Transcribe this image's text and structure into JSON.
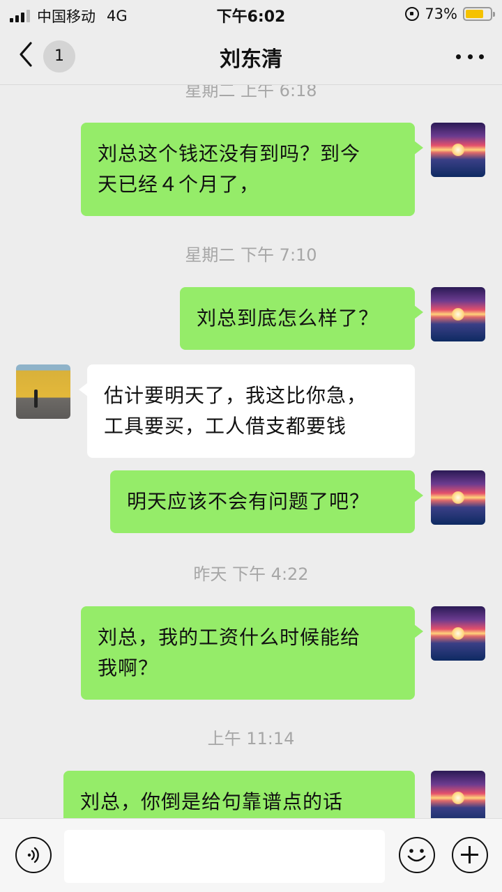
{
  "status_bar": {
    "carrier": "中国移动",
    "network": "4G",
    "time": "下午6:02",
    "battery": "73%",
    "battery_level": 0.73
  },
  "nav": {
    "unread_count": "1",
    "title": "刘东清"
  },
  "messages": [
    {
      "type": "timestamp",
      "text": "星期二 上午 6:18"
    },
    {
      "type": "sent",
      "lines": [
        "刘总这个钱还没有到吗？到今",
        "天已经４个月了，"
      ]
    },
    {
      "type": "timestamp",
      "text": "星期二 下午 7:10"
    },
    {
      "type": "sent",
      "lines": [
        "刘总到底怎么样了？"
      ]
    },
    {
      "type": "received",
      "lines": [
        "估计要明天了，我这比你急，",
        "工具要买，工人借支都要钱"
      ]
    },
    {
      "type": "sent",
      "lines": [
        "明天应该不会有问题了吧？"
      ]
    },
    {
      "type": "timestamp",
      "text": "昨天 下午 4:22"
    },
    {
      "type": "sent",
      "lines": [
        "刘总，我的工资什么时候能给",
        "我啊？"
      ]
    },
    {
      "type": "timestamp",
      "text": "上午 11:14"
    },
    {
      "type": "sent",
      "lines": [
        "刘总，你倒是给句靠谱点的话"
      ]
    }
  ],
  "input": {
    "voice_icon": "voice-icon",
    "emoji_icon": "emoji-icon",
    "plus_icon": "plus-icon",
    "value": ""
  }
}
